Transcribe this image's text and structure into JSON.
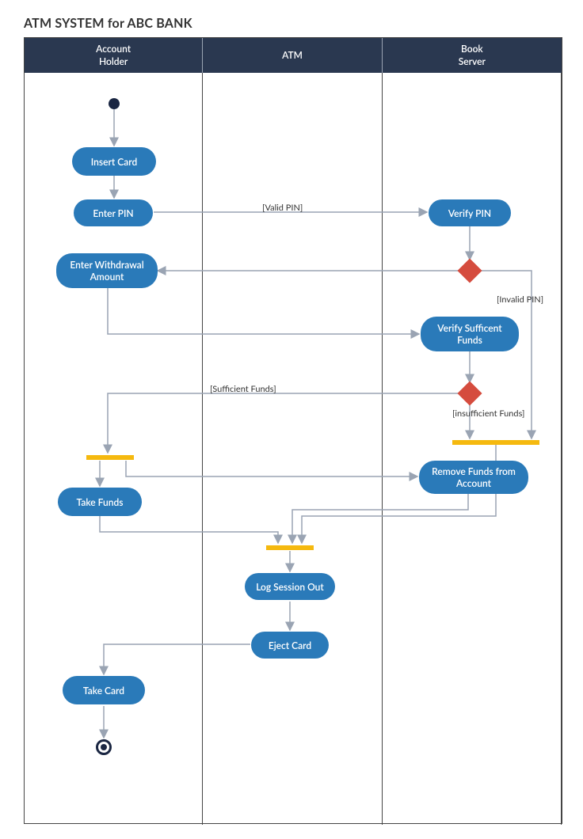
{
  "title": "ATM SYSTEM for ABC BANK",
  "swimlanes": {
    "col1": "Account\nHolder",
    "col2": "ATM",
    "col3": "Book\nServer"
  },
  "activities": {
    "insert_card": "Insert Card",
    "enter_pin": "Enter PIN",
    "verify_pin": "Verify PIN",
    "enter_withdrawal": "Enter Withdrawal\nAmount",
    "verify_funds": "Verify Sufficent\nFunds",
    "take_funds": "Take Funds",
    "remove_funds": "Remove Funds from\nAccount",
    "log_session_out": "Log Session Out",
    "eject_card": "Eject Card",
    "take_card": "Take Card"
  },
  "guards": {
    "valid_pin": "[Valid PIN]",
    "invalid_pin": "[Invalid PIN]",
    "sufficient": "[Sufficient Funds]",
    "insufficient": "[insufficient Funds]"
  },
  "colors": {
    "header": "#2a3850",
    "activity": "#2a7ab9",
    "decision": "#d54c3e",
    "bar": "#f5b90f",
    "arrow": "#9aa4b3"
  }
}
